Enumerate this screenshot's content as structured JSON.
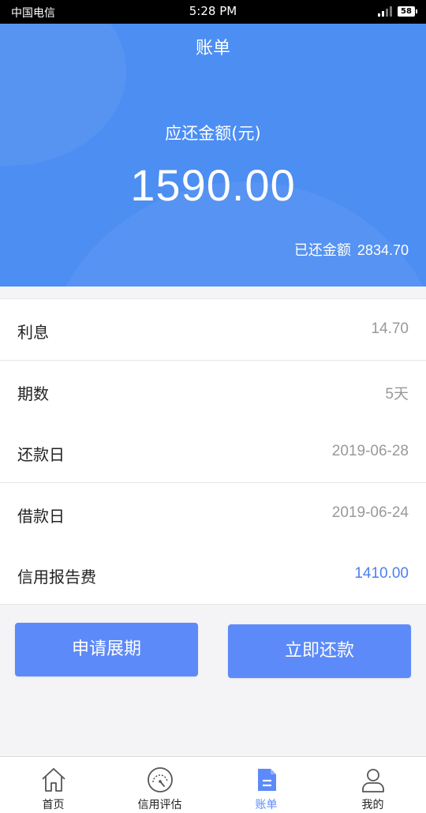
{
  "status_bar": {
    "carrier": "中国电信",
    "time": "5:28 PM",
    "battery": "58"
  },
  "header": {
    "title": "账单",
    "due_label": "应还金额(元)",
    "due_amount": "1590.00",
    "repaid_label": "已还金额",
    "repaid_amount": "2834.70"
  },
  "details": [
    {
      "label": "利息",
      "value": "14.70"
    },
    {
      "label": "期数",
      "value": "5天"
    },
    {
      "label": "还款日",
      "value": "2019-06-28"
    },
    {
      "label": "借款日",
      "value": "2019-06-24"
    },
    {
      "label": "信用报告费",
      "value": "1410.00"
    }
  ],
  "buttons": {
    "extend": "申请展期",
    "repay": "立即还款"
  },
  "tabs": [
    {
      "label": "首页",
      "icon": "home-icon"
    },
    {
      "label": "信用评估",
      "icon": "gauge-icon"
    },
    {
      "label": "账单",
      "icon": "bill-icon"
    },
    {
      "label": "我的",
      "icon": "user-icon"
    }
  ],
  "colors": {
    "primary": "#4d8ef2",
    "button": "#5c8af8",
    "highlight_value": "#4d7ff0"
  }
}
